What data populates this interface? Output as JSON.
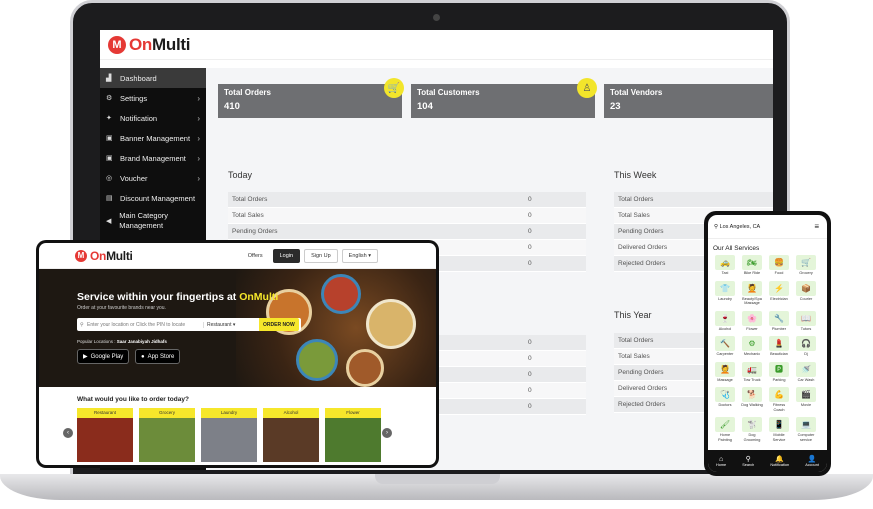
{
  "brand": {
    "mark": "M",
    "name_on": "On",
    "name_multi": "Multi"
  },
  "admin": {
    "sidebar": [
      {
        "label": "Dashboard",
        "icon": "chart-icon",
        "glyph": "▟",
        "active": true
      },
      {
        "label": "Settings",
        "icon": "gear-icon",
        "glyph": "⚙"
      },
      {
        "label": "Notification",
        "icon": "bulb-icon",
        "glyph": "✦"
      },
      {
        "label": "Banner Management",
        "icon": "image-icon",
        "glyph": "▣"
      },
      {
        "label": "Brand Management",
        "icon": "image-icon",
        "glyph": "▣"
      },
      {
        "label": "Voucher",
        "icon": "tag-icon",
        "glyph": "◎"
      },
      {
        "label": "Discount Management",
        "icon": "ticket-icon",
        "glyph": "▤"
      },
      {
        "label": "Main Category Management",
        "icon": "megaphone-icon",
        "glyph": "◀"
      }
    ],
    "stats": [
      {
        "label": "Total Orders",
        "value": "410",
        "icon": "cart-icon",
        "glyph": "🛒"
      },
      {
        "label": "Total Customers",
        "value": "104",
        "icon": "user-icon",
        "glyph": "♙"
      },
      {
        "label": "Total Vendors",
        "value": "23",
        "icon": "store-icon",
        "glyph": ""
      }
    ],
    "panels": {
      "today": "Today",
      "this_week": "This Week",
      "this_year": "This Year"
    },
    "today_rows": [
      {
        "label": "Total Orders",
        "value": "0"
      },
      {
        "label": "Total Sales",
        "value": "0"
      },
      {
        "label": "Pending Orders",
        "value": "0"
      },
      {
        "label": "Delivered Orders",
        "value": "0"
      },
      {
        "label": "Rejected Orders",
        "value": "0"
      }
    ],
    "week_rows": [
      {
        "label": "Total Orders"
      },
      {
        "label": "Total Sales"
      },
      {
        "label": "Pending Orders"
      },
      {
        "label": "Delivered Orders"
      },
      {
        "label": "Rejected Orders"
      }
    ],
    "month_values": [
      "0",
      "0",
      "0",
      "0",
      "0"
    ],
    "year_rows": [
      {
        "label": "Total Orders"
      },
      {
        "label": "Total Sales"
      },
      {
        "label": "Pending Orders"
      },
      {
        "label": "Delivered Orders"
      },
      {
        "label": "Rejected Orders"
      }
    ]
  },
  "web": {
    "nav": {
      "offers": "Offers",
      "login": "Login",
      "signup": "Sign Up",
      "language": "English"
    },
    "hero": {
      "title_prefix": "Service within your fingertips at ",
      "title_highlight": "OnMulti",
      "subtitle": "Order at your favourite brands near you.",
      "search_placeholder": "Enter your location or Click the PIN to locate",
      "category_select": "Restaurant",
      "order_button": "ORDER NOW",
      "popular_label": "Popular Locations :",
      "popular_locations": "Saar  Janabiyah  Jidhafs",
      "google_play": "Google Play",
      "app_store": "App Store"
    },
    "categories_title": "What would you like to order today?",
    "categories": [
      {
        "label": "Restaurant",
        "color": "#8a2c1c"
      },
      {
        "label": "Grocery",
        "color": "#6c8c3a"
      },
      {
        "label": "Laundry",
        "color": "#7d8088"
      },
      {
        "label": "Alcohol",
        "color": "#5a3a26"
      },
      {
        "label": "Flower",
        "color": "#4e7a2e"
      }
    ]
  },
  "mobile": {
    "location": "Los Angeles, CA",
    "section_title": "Our All Services",
    "services": [
      "Taxi",
      "Bike Ride",
      "Food",
      "Grocery",
      "Laundry",
      "Beauty/Spa Massage",
      "Electrician",
      "Courier",
      "Alcohol",
      "Flower",
      "Plumber",
      "Tutors",
      "Carpenter",
      "Mechanic",
      "Beautician",
      "Dj",
      "Massage",
      "Tow Truck",
      "Parking",
      "Car Wash",
      "Doctors",
      "Dog Walking",
      "Fitness Coach",
      "Movie",
      "Home Painting",
      "Dog Grooming",
      "Mobile Service",
      "Computer service"
    ],
    "tabs": [
      "Home",
      "Search",
      "Notification",
      "Account"
    ]
  }
}
